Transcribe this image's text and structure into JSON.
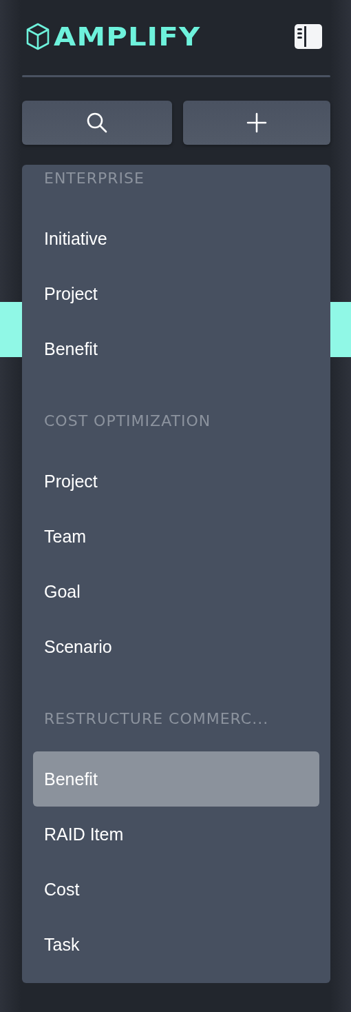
{
  "logo": {
    "text": "AMPLIFY"
  },
  "menu": {
    "groups": [
      {
        "heading": "ENTERPRISE",
        "items": [
          {
            "label": "Initiative",
            "selected": false
          },
          {
            "label": "Project",
            "selected": false
          },
          {
            "label": "Benefit",
            "selected": false
          }
        ]
      },
      {
        "heading": "COST OPTIMIZATION",
        "items": [
          {
            "label": "Project",
            "selected": false
          },
          {
            "label": "Team",
            "selected": false
          },
          {
            "label": "Goal",
            "selected": false
          },
          {
            "label": "Scenario",
            "selected": false
          }
        ]
      },
      {
        "heading": "RESTRUCTURE COMMERC...",
        "items": [
          {
            "label": "Benefit",
            "selected": true
          },
          {
            "label": "RAID Item",
            "selected": false
          },
          {
            "label": "Cost",
            "selected": false
          },
          {
            "label": "Task",
            "selected": false
          }
        ]
      }
    ]
  }
}
